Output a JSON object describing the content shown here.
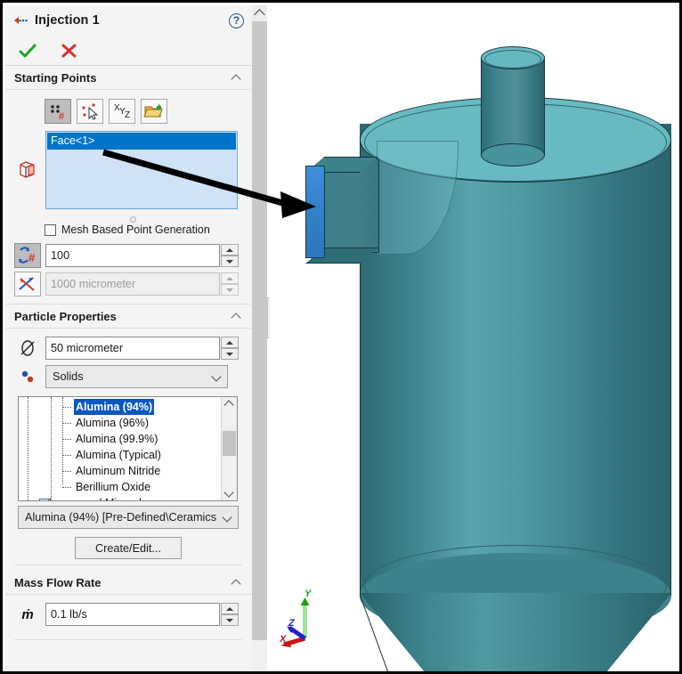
{
  "window": {
    "title": "Injection 1",
    "title_icon": "injection-icon",
    "help_icon": "help-question-icon",
    "ok_icon": "green-check-icon",
    "cancel_icon": "red-x-icon"
  },
  "sections": {
    "starting_points": {
      "title": "Starting Points",
      "collapse_icon": "chevron-up-icon",
      "tools": [
        {
          "name": "pattern-points-tool",
          "icon": "points-hash-icon",
          "active": true
        },
        {
          "name": "pick-points-tool",
          "icon": "cursor-points-icon",
          "active": false
        },
        {
          "name": "xyz-coordinates-tool",
          "icon": "xyz-axes-icon",
          "active": false
        },
        {
          "name": "import-points-tool",
          "icon": "open-folder-import-icon",
          "active": false
        }
      ],
      "selection_icon": "face-reference-icon",
      "selection_items": [
        "Face<1>"
      ],
      "mesh_based_checkbox": {
        "label": "Mesh Based Point Generation",
        "checked": false
      },
      "point_count": {
        "icon": "number-of-points-icon",
        "value": "100",
        "enabled": true
      },
      "point_spacing": {
        "icon": "point-distance-icon",
        "value": "1000 micrometer",
        "enabled": false
      }
    },
    "particle_properties": {
      "title": "Particle Properties",
      "collapse_icon": "chevron-up-icon",
      "diameter": {
        "icon": "diameter-icon",
        "value": "50 micrometer"
      },
      "material_type": {
        "icon": "substance-icon",
        "value": "Solids",
        "arrow_icon": "chevron-down-icon"
      },
      "material_tree": {
        "items": [
          {
            "label": "Alumina (94%)",
            "selected": true,
            "type": "leaf"
          },
          {
            "label": "Alumina (96%)",
            "selected": false,
            "type": "leaf"
          },
          {
            "label": "Alumina (99.9%)",
            "selected": false,
            "type": "leaf"
          },
          {
            "label": "Alumina (Typical)",
            "selected": false,
            "type": "leaf"
          },
          {
            "label": "Aluminum Nitride",
            "selected": false,
            "type": "leaf"
          },
          {
            "label": "Berillium Oxide",
            "selected": false,
            "type": "leaf"
          },
          {
            "label": "Glasses and Minerals",
            "selected": false,
            "type": "group",
            "expand_icon": "plus-box-icon"
          }
        ],
        "scroll_up_icon": "scroll-up-arrow-icon",
        "scroll_down_icon": "scroll-down-arrow-icon"
      },
      "selected_material": {
        "value": "Alumina (94%) [Pre-Defined\\Ceramics",
        "arrow_icon": "chevron-down-icon"
      },
      "create_edit_button": "Create/Edit..."
    },
    "mass_flow_rate": {
      "title": "Mass Flow Rate",
      "collapse_icon": "chevron-up-icon",
      "symbol": "ṁ",
      "value": "0.1 lb/s"
    }
  },
  "panel_scrollbar": {
    "up_icon": "scroll-up-arrow-icon"
  },
  "collapse_handle": {
    "name": "panel-collapse-handle",
    "icon": "handle-dot-icon"
  },
  "graphics": {
    "model_name": "cylindrical-vessel-model",
    "selected_face_color": "#3281c9",
    "body_color": "#3d838c",
    "top_face_color": "#68bac2",
    "annotation_arrow": "callout-arrow",
    "axis_triad": {
      "x_label": "X",
      "y_label": "Y",
      "z_label": "Z",
      "x_color": "#cc1111",
      "y_color": "#1aa01a",
      "z_color": "#2222cc"
    }
  }
}
